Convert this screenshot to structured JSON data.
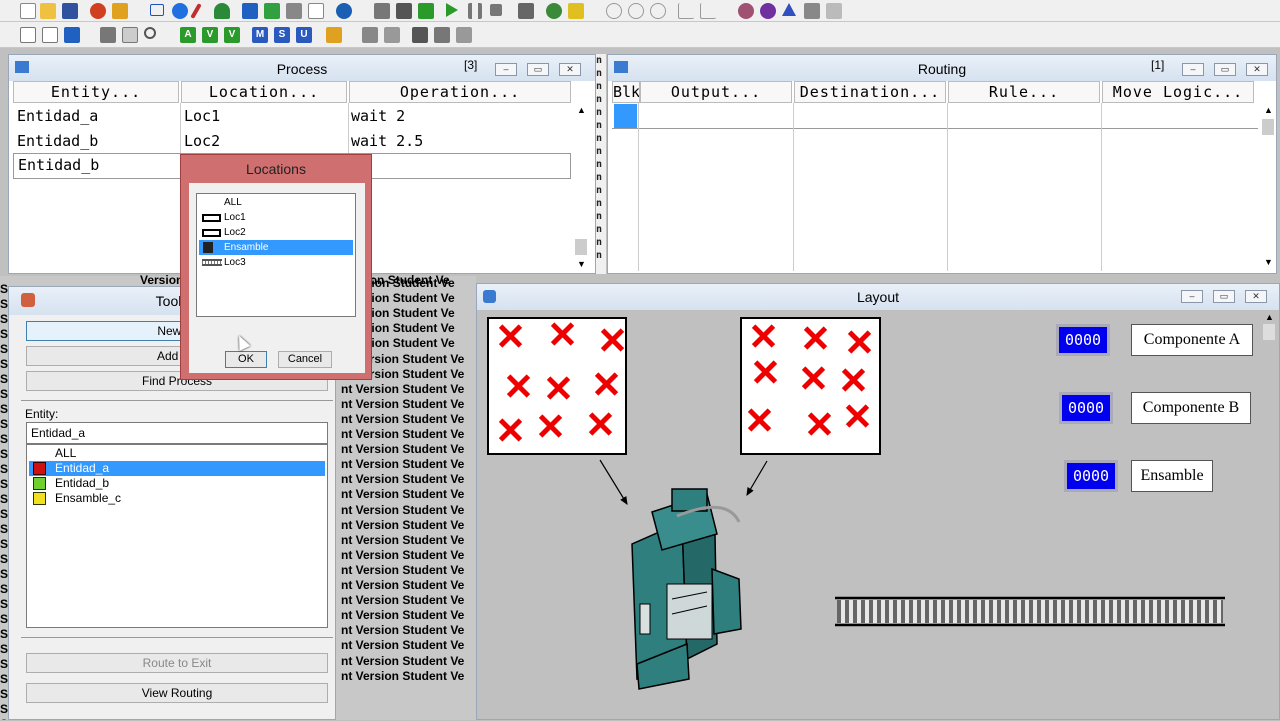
{
  "toolbar": {
    "row1_icons": [
      "new-icon",
      "open-icon",
      "save-icon",
      "build-icon",
      "options-icon",
      "rectangle-icon",
      "circle-icon",
      "line-icon",
      "person-icon",
      "arrow-right-icon",
      "download-icon",
      "copy-icon",
      "table-icon",
      "info-icon",
      "layout-icon",
      "window-icon",
      "run-icon",
      "play-icon",
      "pause-icon",
      "stop-icon",
      "grid-icon",
      "globe-icon",
      "gauge-icon",
      "filter-icon",
      "filter2-icon",
      "filter3-icon",
      "chart-icon",
      "chart2-icon",
      "palette-icon",
      "spiral-icon",
      "triangle-icon",
      "paint-icon",
      "view-icon"
    ],
    "row2_icons": [
      "list-icon",
      "edit-icon",
      "export-icon",
      "truck-icon",
      "picture-icon",
      "magnify-icon"
    ],
    "row2_letters": [
      "A",
      "V",
      "V",
      "M",
      "S",
      "U"
    ],
    "row2_tail_icons": [
      "lock-icon",
      "tools-icon",
      "refresh-icon",
      "align-icon",
      "unlink-icon",
      "delete-icon"
    ]
  },
  "process": {
    "title": "Process",
    "count": "[3]",
    "columns": [
      "Entity...",
      "Location...",
      "Operation..."
    ],
    "rows": [
      {
        "entity": "Entidad_a",
        "location": "Loc1",
        "operation": "wait 2"
      },
      {
        "entity": "Entidad_b",
        "location": "Loc2",
        "operation": "wait 2.5"
      },
      {
        "entity": "Entidad_b",
        "location": "",
        "operation": ""
      }
    ]
  },
  "routing": {
    "title": "Routing",
    "count": "[1]",
    "columns": [
      "Blk",
      "Output...",
      "Destination...",
      "Rule...",
      "Move Logic..."
    ]
  },
  "locations_dialog": {
    "title": "Locations",
    "items": [
      "ALL",
      "Loc1",
      "Loc2",
      "Ensamble",
      "Loc3"
    ],
    "selected": "Ensamble",
    "ok": "OK",
    "cancel": "Cancel"
  },
  "tools": {
    "title": "Tools",
    "new_process": "New Pr",
    "add_routing": "Add Ro",
    "find_process": "Find Process",
    "entity_label": "Entity:",
    "entity_value": "Entidad_a",
    "entities": [
      "ALL",
      "Entidad_a",
      "Entidad_b",
      "Ensamble_c"
    ],
    "selected": "Entidad_a",
    "route_to_exit": "Route to Exit",
    "view_routing": "View Routing"
  },
  "watermark": "nt Version Student Ve",
  "watermark_top": "Version Student Ve",
  "layout": {
    "title": "Layout",
    "counters": [
      {
        "value": "0000",
        "label": "Componente A"
      },
      {
        "value": "0000",
        "label": "Componente B"
      },
      {
        "value": "0000",
        "label": "Ensamble"
      }
    ]
  },
  "colors": {
    "selection": "#3399ff",
    "dialog_border": "#c85a5a",
    "counter_bg": "#0000ee",
    "machine": "#2f7f7f"
  }
}
